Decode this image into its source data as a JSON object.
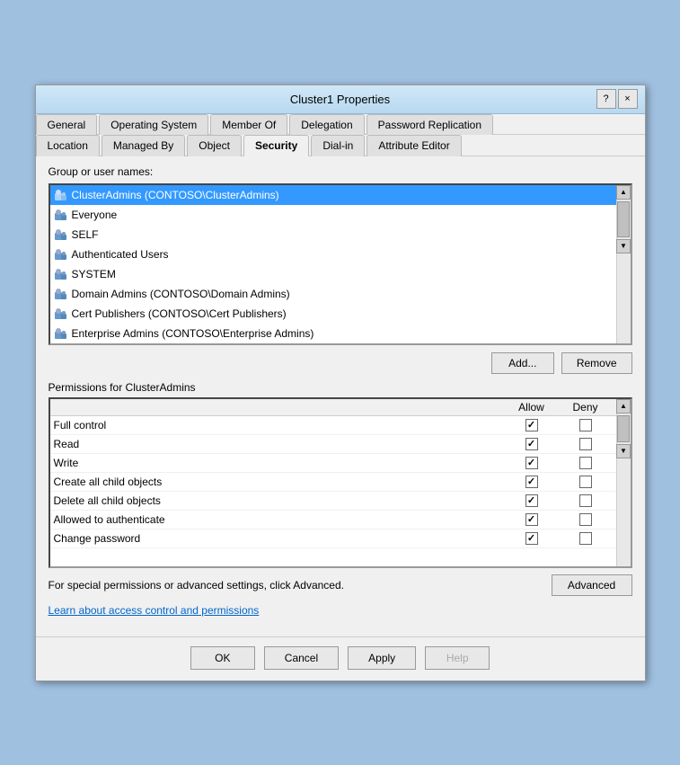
{
  "window": {
    "title": "Cluster1 Properties",
    "help_label": "?",
    "close_label": "×"
  },
  "tabs": {
    "row1": [
      {
        "id": "general",
        "label": "General"
      },
      {
        "id": "operating-system",
        "label": "Operating System"
      },
      {
        "id": "member-of",
        "label": "Member Of"
      },
      {
        "id": "delegation",
        "label": "Delegation"
      },
      {
        "id": "password-replication",
        "label": "Password Replication"
      }
    ],
    "row2": [
      {
        "id": "location",
        "label": "Location"
      },
      {
        "id": "managed-by",
        "label": "Managed By"
      },
      {
        "id": "object",
        "label": "Object"
      },
      {
        "id": "security",
        "label": "Security",
        "active": true
      },
      {
        "id": "dial-in",
        "label": "Dial-in"
      },
      {
        "id": "attribute-editor",
        "label": "Attribute Editor"
      }
    ]
  },
  "section": {
    "group_label": "Group or user names:",
    "users": [
      {
        "id": 1,
        "name": "ClusterAdmins (CONTOSO\\ClusterAdmins)",
        "selected": true
      },
      {
        "id": 2,
        "name": "Everyone",
        "selected": false
      },
      {
        "id": 3,
        "name": "SELF",
        "selected": false
      },
      {
        "id": 4,
        "name": "Authenticated Users",
        "selected": false
      },
      {
        "id": 5,
        "name": "SYSTEM",
        "selected": false
      },
      {
        "id": 6,
        "name": "Domain Admins (CONTOSO\\Domain Admins)",
        "selected": false
      },
      {
        "id": 7,
        "name": "Cert Publishers (CONTOSO\\Cert Publishers)",
        "selected": false
      },
      {
        "id": 8,
        "name": "Enterprise Admins (CONTOSO\\Enterprise Admins)",
        "selected": false
      }
    ],
    "add_label": "Add...",
    "remove_label": "Remove",
    "permissions_for": "Permissions for ClusterAdmins",
    "allow_col": "Allow",
    "deny_col": "Deny",
    "permissions": [
      {
        "name": "Full control",
        "allow": true,
        "deny": false
      },
      {
        "name": "Read",
        "allow": true,
        "deny": false
      },
      {
        "name": "Write",
        "allow": true,
        "deny": false
      },
      {
        "name": "Create all child objects",
        "allow": true,
        "deny": false
      },
      {
        "name": "Delete all child objects",
        "allow": true,
        "deny": false
      },
      {
        "name": "Allowed to authenticate",
        "allow": true,
        "deny": false
      },
      {
        "name": "Change password",
        "allow": true,
        "deny": false
      }
    ],
    "special_perms_text": "For special permissions or advanced settings, click Advanced.",
    "advanced_label": "Advanced",
    "learn_link": "Learn about access control and permissions"
  },
  "footer": {
    "ok": "OK",
    "cancel": "Cancel",
    "apply": "Apply",
    "help": "Help"
  }
}
